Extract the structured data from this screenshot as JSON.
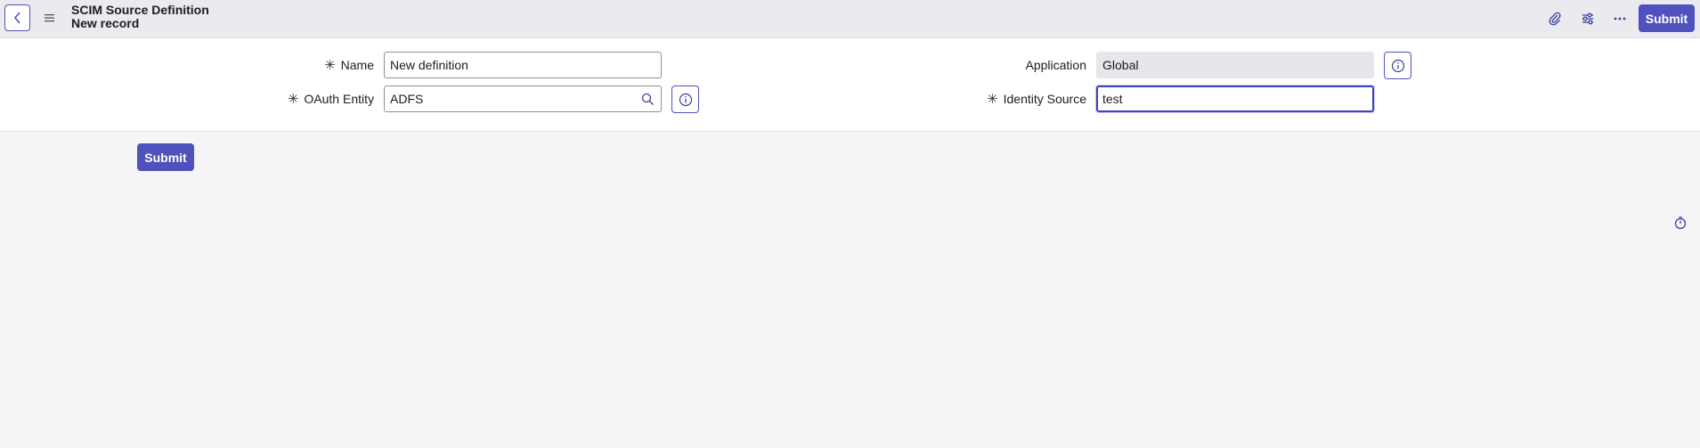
{
  "header": {
    "title": "SCIM Source Definition",
    "subtitle": "New record",
    "submit_label": "Submit",
    "icons": [
      "back-icon",
      "menu-icon",
      "paperclip-icon",
      "sliders-icon",
      "more-icon"
    ]
  },
  "form": {
    "name": {
      "label": "Name",
      "value": "New definition",
      "required": "✳"
    },
    "oauth_entity": {
      "label": "OAuth Entity",
      "value": "ADFS",
      "required": "✳"
    },
    "application": {
      "label": "Application",
      "value": "Global"
    },
    "identity_source": {
      "label": "Identity Source",
      "value": "test",
      "required": "✳"
    }
  },
  "footer": {
    "submit_label": "Submit"
  },
  "colors": {
    "accent": "#4f52bd",
    "header_bg": "#eaeaef",
    "page_bg": "#f5f5f8"
  }
}
